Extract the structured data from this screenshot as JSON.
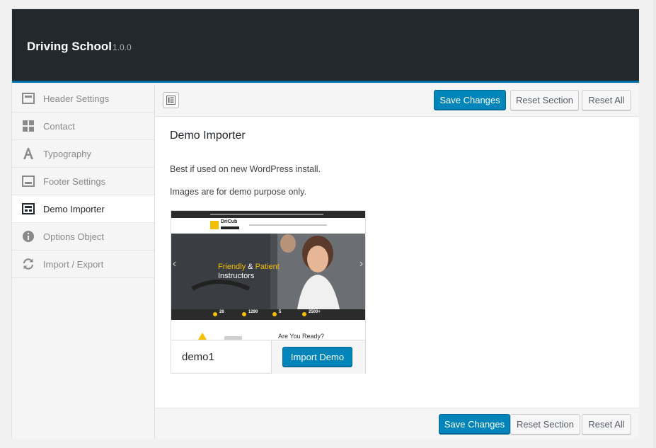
{
  "header": {
    "title": "Driving School",
    "version": "1.0.0"
  },
  "sidebar": {
    "items": [
      {
        "label": "Header Settings",
        "icon": "header-settings-icon"
      },
      {
        "label": "Contact",
        "icon": "grid-icon"
      },
      {
        "label": "Typography",
        "icon": "typography-icon"
      },
      {
        "label": "Footer Settings",
        "icon": "footer-settings-icon"
      },
      {
        "label": "Demo Importer",
        "icon": "demo-importer-icon",
        "active": true
      },
      {
        "label": "Options Object",
        "icon": "info-icon"
      },
      {
        "label": "Import / Export",
        "icon": "refresh-icon"
      }
    ]
  },
  "toolbar": {
    "save_label": "Save Changes",
    "reset_section_label": "Reset Section",
    "reset_all_label": "Reset All"
  },
  "section": {
    "title": "Demo Importer",
    "desc1": "Best if used on new WordPress install.",
    "desc2": "Images are for demo purpose only."
  },
  "demo": {
    "name": "demo1",
    "import_label": "Import Demo",
    "thumb": {
      "logo": "DriCub",
      "hero_line1_yellow": "Friendly",
      "hero_line1_white": " & ",
      "hero_line1_yellow2": "Patient",
      "hero_line2": "Instructors",
      "cta": "Are You Ready?",
      "stats": [
        "26",
        "1290",
        "5",
        "2500+"
      ]
    }
  },
  "colors": {
    "header_bg": "#23282d",
    "accent": "#0085ba",
    "header_border": "#0073aa"
  }
}
